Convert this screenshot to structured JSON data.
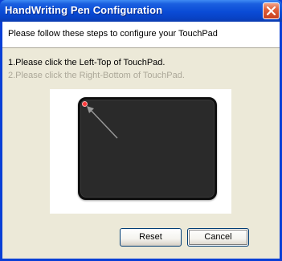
{
  "window": {
    "title": "HandWriting Pen Configuration"
  },
  "header": {
    "instruction": "Please follow these steps to configure your TouchPad"
  },
  "steps": [
    {
      "text": "1.Please click the Left-Top of TouchPad.",
      "state": "active"
    },
    {
      "text": "2.Please click the Right-Bottom of TouchPad.",
      "state": "disabled"
    }
  ],
  "buttons": {
    "reset_label": "Reset",
    "cancel_label": "Cancel"
  },
  "colors": {
    "titlebar": "#0a4bd6",
    "dialog_bg": "#ece9d8",
    "pad": "#2a2a2a",
    "target_dot": "#ff3a3a",
    "disabled_text": "#aca899"
  },
  "icons": {
    "close": "close-icon",
    "target": "target-dot-icon",
    "pointer": "pointer-arrow-icon"
  }
}
